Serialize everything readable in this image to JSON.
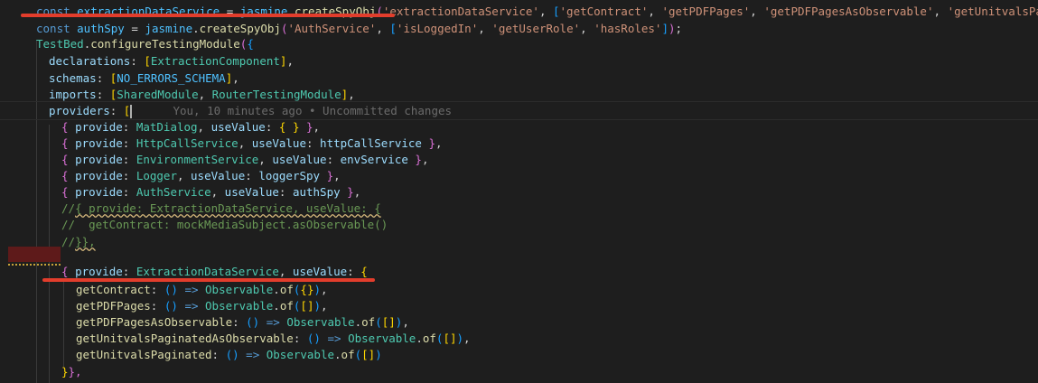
{
  "editor": {
    "lines": [
      {
        "tokens": [
          {
            "t": "const ",
            "c": "k"
          },
          {
            "t": "extractionDataService",
            "c": "v"
          },
          {
            "t": " = ",
            "c": "pl"
          },
          {
            "t": "jasmine",
            "c": "v"
          },
          {
            "t": ".",
            "c": "pl"
          },
          {
            "t": "createSpyObj",
            "c": "f"
          },
          {
            "t": "(",
            "c": "m"
          },
          {
            "t": "'extractionDataService'",
            "c": "s"
          },
          {
            "t": ", ",
            "c": "pl"
          },
          {
            "t": "[",
            "c": "b"
          },
          {
            "t": "'getContract'",
            "c": "s"
          },
          {
            "t": ", ",
            "c": "pl"
          },
          {
            "t": "'getPDFPages'",
            "c": "s"
          },
          {
            "t": ", ",
            "c": "pl"
          },
          {
            "t": "'getPDFPagesAsObservable'",
            "c": "s"
          },
          {
            "t": ", ",
            "c": "pl"
          },
          {
            "t": "'getUnitvalsPaginate",
            "c": "s"
          }
        ]
      },
      {
        "tokens": [
          {
            "t": "const ",
            "c": "k"
          },
          {
            "t": "authSpy",
            "c": "v"
          },
          {
            "t": " = ",
            "c": "pl"
          },
          {
            "t": "jasmine",
            "c": "v"
          },
          {
            "t": ".",
            "c": "pl"
          },
          {
            "t": "createSpyObj",
            "c": "f"
          },
          {
            "t": "(",
            "c": "m"
          },
          {
            "t": "'AuthService'",
            "c": "s"
          },
          {
            "t": ", ",
            "c": "pl"
          },
          {
            "t": "[",
            "c": "b"
          },
          {
            "t": "'isLoggedIn'",
            "c": "s"
          },
          {
            "t": ", ",
            "c": "pl"
          },
          {
            "t": "'getUserRole'",
            "c": "s"
          },
          {
            "t": ", ",
            "c": "pl"
          },
          {
            "t": "'hasRoles'",
            "c": "s"
          },
          {
            "t": "]",
            "c": "b"
          },
          {
            "t": ")",
            "c": "m"
          },
          {
            "t": ";",
            "c": "pl"
          }
        ]
      },
      {
        "tokens": [
          {
            "t": "TestBed",
            "c": "t"
          },
          {
            "t": ".",
            "c": "pl"
          },
          {
            "t": "configureTestingModule",
            "c": "f"
          },
          {
            "t": "(",
            "c": "m"
          },
          {
            "t": "{",
            "c": "b"
          }
        ]
      },
      {
        "tokens": [
          {
            "t": "declarations",
            "c": "p"
          },
          {
            "t": ": ",
            "c": "pl"
          },
          {
            "t": "[",
            "c": "y"
          },
          {
            "t": "ExtractionComponent",
            "c": "t"
          },
          {
            "t": "]",
            "c": "y"
          },
          {
            "t": ",",
            "c": "pl"
          }
        ]
      },
      {
        "tokens": [
          {
            "t": "schemas",
            "c": "p"
          },
          {
            "t": ": ",
            "c": "pl"
          },
          {
            "t": "[",
            "c": "y"
          },
          {
            "t": "NO_ERRORS_SCHEMA",
            "c": "v"
          },
          {
            "t": "]",
            "c": "y"
          },
          {
            "t": ",",
            "c": "pl"
          }
        ]
      },
      {
        "tokens": [
          {
            "t": "imports",
            "c": "p"
          },
          {
            "t": ": ",
            "c": "pl"
          },
          {
            "t": "[",
            "c": "y"
          },
          {
            "t": "SharedModule",
            "c": "t"
          },
          {
            "t": ", ",
            "c": "pl"
          },
          {
            "t": "RouterTestingModule",
            "c": "t"
          },
          {
            "t": "]",
            "c": "y"
          },
          {
            "t": ",",
            "c": "pl"
          }
        ]
      },
      {
        "tokens": [
          {
            "t": "providers",
            "c": "p"
          },
          {
            "t": ": ",
            "c": "pl"
          },
          {
            "t": "[",
            "c": "y"
          }
        ],
        "cursor": true,
        "blame": "You, 10 minutes ago • Uncommitted changes"
      },
      {
        "tokens": [
          {
            "t": "{ ",
            "c": "m"
          },
          {
            "t": "provide",
            "c": "p"
          },
          {
            "t": ": ",
            "c": "pl"
          },
          {
            "t": "MatDialog",
            "c": "t"
          },
          {
            "t": ", ",
            "c": "pl"
          },
          {
            "t": "useValue",
            "c": "p"
          },
          {
            "t": ": ",
            "c": "pl"
          },
          {
            "t": "{ }",
            "c": "y"
          },
          {
            "t": " }",
            "c": "m"
          },
          {
            "t": ",",
            "c": "pl"
          }
        ]
      },
      {
        "tokens": [
          {
            "t": "{ ",
            "c": "m"
          },
          {
            "t": "provide",
            "c": "p"
          },
          {
            "t": ": ",
            "c": "pl"
          },
          {
            "t": "HttpCallService",
            "c": "t"
          },
          {
            "t": ", ",
            "c": "pl"
          },
          {
            "t": "useValue",
            "c": "p"
          },
          {
            "t": ": ",
            "c": "pl"
          },
          {
            "t": "httpCallService",
            "c": "p"
          },
          {
            "t": " }",
            "c": "m"
          },
          {
            "t": ",",
            "c": "pl"
          }
        ]
      },
      {
        "tokens": [
          {
            "t": "{ ",
            "c": "m"
          },
          {
            "t": "provide",
            "c": "p"
          },
          {
            "t": ": ",
            "c": "pl"
          },
          {
            "t": "EnvironmentService",
            "c": "t"
          },
          {
            "t": ", ",
            "c": "pl"
          },
          {
            "t": "useValue",
            "c": "p"
          },
          {
            "t": ": ",
            "c": "pl"
          },
          {
            "t": "envService",
            "c": "p"
          },
          {
            "t": " }",
            "c": "m"
          },
          {
            "t": ",",
            "c": "pl"
          }
        ]
      },
      {
        "tokens": [
          {
            "t": "{ ",
            "c": "m"
          },
          {
            "t": "provide",
            "c": "p"
          },
          {
            "t": ": ",
            "c": "pl"
          },
          {
            "t": "Logger",
            "c": "t"
          },
          {
            "t": ", ",
            "c": "pl"
          },
          {
            "t": "useValue",
            "c": "p"
          },
          {
            "t": ": ",
            "c": "pl"
          },
          {
            "t": "loggerSpy",
            "c": "p"
          },
          {
            "t": " }",
            "c": "m"
          },
          {
            "t": ",",
            "c": "pl"
          }
        ]
      },
      {
        "tokens": [
          {
            "t": "{ ",
            "c": "m"
          },
          {
            "t": "provide",
            "c": "p"
          },
          {
            "t": ": ",
            "c": "pl"
          },
          {
            "t": "AuthService",
            "c": "t"
          },
          {
            "t": ", ",
            "c": "pl"
          },
          {
            "t": "useValue",
            "c": "p"
          },
          {
            "t": ": ",
            "c": "pl"
          },
          {
            "t": "authSpy",
            "c": "p"
          },
          {
            "t": " }",
            "c": "m"
          },
          {
            "t": ",",
            "c": "pl"
          }
        ]
      },
      {
        "tokens": [
          {
            "t": "//",
            "c": "c"
          },
          {
            "t": "{ provide: ExtractionDataService, useValue: {",
            "c": "c",
            "squiggle": true
          }
        ]
      },
      {
        "tokens": [
          {
            "t": "//  getContract: mockMediaSubject.asObservable()",
            "c": "c"
          }
        ]
      },
      {
        "tokens": [
          {
            "t": "//",
            "c": "c"
          },
          {
            "t": "}},",
            "c": "c",
            "squiggle": true
          }
        ]
      },
      {
        "tokens": []
      },
      {
        "tokens": [
          {
            "t": "{ ",
            "c": "m"
          },
          {
            "t": "provide",
            "c": "p"
          },
          {
            "t": ": ",
            "c": "pl"
          },
          {
            "t": "ExtractionDataService",
            "c": "t"
          },
          {
            "t": ", ",
            "c": "pl"
          },
          {
            "t": "useValue",
            "c": "p"
          },
          {
            "t": ": ",
            "c": "pl"
          },
          {
            "t": "{",
            "c": "y"
          }
        ]
      },
      {
        "tokens": [
          {
            "t": "getContract",
            "c": "f"
          },
          {
            "t": ": ",
            "c": "pl"
          },
          {
            "t": "()",
            "c": "b"
          },
          {
            "t": " => ",
            "c": "k"
          },
          {
            "t": "Observable",
            "c": "t"
          },
          {
            "t": ".",
            "c": "pl"
          },
          {
            "t": "of",
            "c": "f"
          },
          {
            "t": "(",
            "c": "b"
          },
          {
            "t": "{}",
            "c": "y"
          },
          {
            "t": ")",
            "c": "b"
          },
          {
            "t": ",",
            "c": "pl"
          }
        ]
      },
      {
        "tokens": [
          {
            "t": "getPDFPages",
            "c": "f"
          },
          {
            "t": ": ",
            "c": "pl"
          },
          {
            "t": "()",
            "c": "b"
          },
          {
            "t": " => ",
            "c": "k"
          },
          {
            "t": "Observable",
            "c": "t"
          },
          {
            "t": ".",
            "c": "pl"
          },
          {
            "t": "of",
            "c": "f"
          },
          {
            "t": "(",
            "c": "b"
          },
          {
            "t": "[]",
            "c": "y"
          },
          {
            "t": ")",
            "c": "b"
          },
          {
            "t": ",",
            "c": "pl"
          }
        ]
      },
      {
        "tokens": [
          {
            "t": "getPDFPagesAsObservable",
            "c": "f"
          },
          {
            "t": ": ",
            "c": "pl"
          },
          {
            "t": "()",
            "c": "b"
          },
          {
            "t": " => ",
            "c": "k"
          },
          {
            "t": "Observable",
            "c": "t"
          },
          {
            "t": ".",
            "c": "pl"
          },
          {
            "t": "of",
            "c": "f"
          },
          {
            "t": "(",
            "c": "b"
          },
          {
            "t": "[]",
            "c": "y"
          },
          {
            "t": ")",
            "c": "b"
          },
          {
            "t": ",",
            "c": "pl"
          }
        ]
      },
      {
        "tokens": [
          {
            "t": "getUnitvalsPaginatedAsObservable",
            "c": "f"
          },
          {
            "t": ": ",
            "c": "pl"
          },
          {
            "t": "()",
            "c": "b"
          },
          {
            "t": " => ",
            "c": "k"
          },
          {
            "t": "Observable",
            "c": "t"
          },
          {
            "t": ".",
            "c": "pl"
          },
          {
            "t": "of",
            "c": "f"
          },
          {
            "t": "(",
            "c": "b"
          },
          {
            "t": "[]",
            "c": "y"
          },
          {
            "t": ")",
            "c": "b"
          },
          {
            "t": ",",
            "c": "pl"
          }
        ]
      },
      {
        "tokens": [
          {
            "t": "getUnitvalsPaginated",
            "c": "f"
          },
          {
            "t": ": ",
            "c": "pl"
          },
          {
            "t": "()",
            "c": "b"
          },
          {
            "t": " => ",
            "c": "k"
          },
          {
            "t": "Observable",
            "c": "t"
          },
          {
            "t": ".",
            "c": "pl"
          },
          {
            "t": "of",
            "c": "f"
          },
          {
            "t": "(",
            "c": "b"
          },
          {
            "t": "[]",
            "c": "y"
          },
          {
            "t": ")",
            "c": "b"
          }
        ]
      },
      {
        "tokens": [
          {
            "t": "}",
            "c": "y"
          },
          {
            "t": "},",
            "c": "m"
          }
        ]
      }
    ]
  }
}
